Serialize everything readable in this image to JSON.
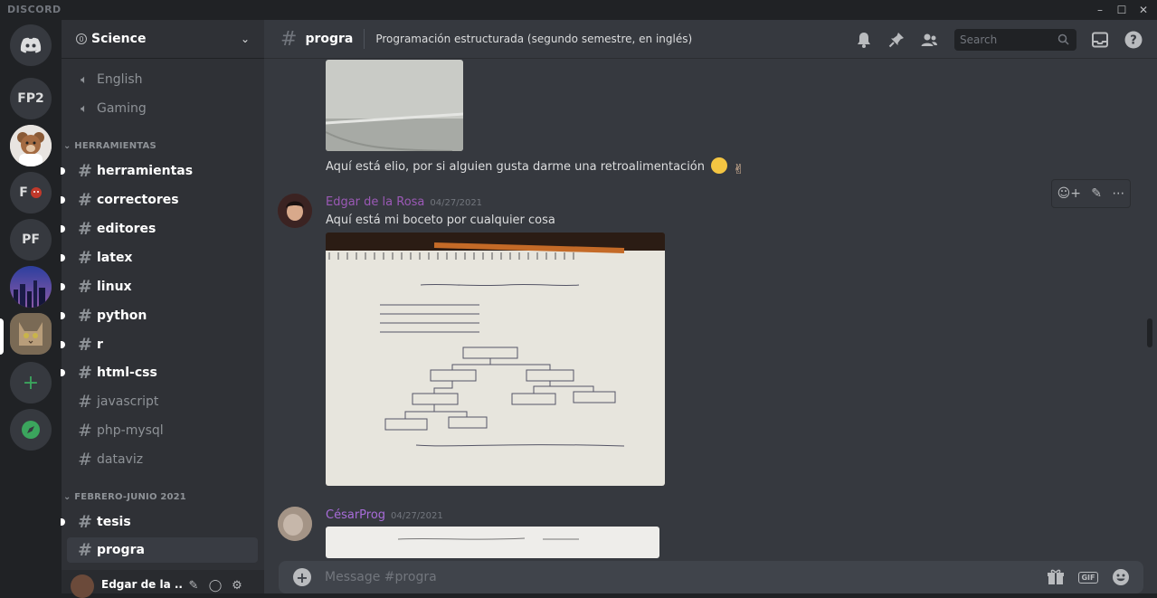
{
  "titlebar": {
    "brand": "DISCORD"
  },
  "guilds": [
    {
      "label": "FP2"
    },
    {
      "label": "F"
    },
    {
      "label": "PF"
    }
  ],
  "server": {
    "name": "Science",
    "badge": "0"
  },
  "channels": {
    "voice": [
      "English",
      "Gaming"
    ],
    "categories": [
      "HERRAMIENTAS",
      "FEBRERO-JUNIO 2021"
    ],
    "herramientas": [
      {
        "name": "herramientas",
        "unread": true
      },
      {
        "name": "correctores",
        "unread": true
      },
      {
        "name": "editores",
        "unread": true
      },
      {
        "name": "latex",
        "unread": true
      },
      {
        "name": "linux",
        "unread": true
      },
      {
        "name": "python",
        "unread": true
      },
      {
        "name": "r",
        "unread": true
      },
      {
        "name": "html-css",
        "unread": true
      },
      {
        "name": "javascript",
        "unread": false
      },
      {
        "name": "php-mysql",
        "unread": false
      },
      {
        "name": "dataviz",
        "unread": false
      }
    ],
    "febrero": [
      {
        "name": "tesis",
        "unread": true
      },
      {
        "name": "progra",
        "active": true
      }
    ]
  },
  "user": {
    "name": "Edgar de la ..."
  },
  "topbar": {
    "channel": "progra",
    "topic": "Programación estructurada (segundo semestre, en inglés)",
    "search_placeholder": "Search"
  },
  "messages": {
    "first_caption": "Aquí está elio, por si alguien gusta darme una retroalimentación",
    "m1": {
      "author": "Edgar de la Rosa",
      "time": "04/27/2021",
      "text": "Aquí está mi boceto por cualquier cosa"
    },
    "m2": {
      "author": "CésarProg",
      "time": "04/27/2021"
    }
  },
  "composer": {
    "placeholder": "Message #progra",
    "gif": "GIF"
  },
  "colors": {
    "accent": "#5865f2",
    "green": "#3ba55d",
    "author": "#9b59b6"
  }
}
